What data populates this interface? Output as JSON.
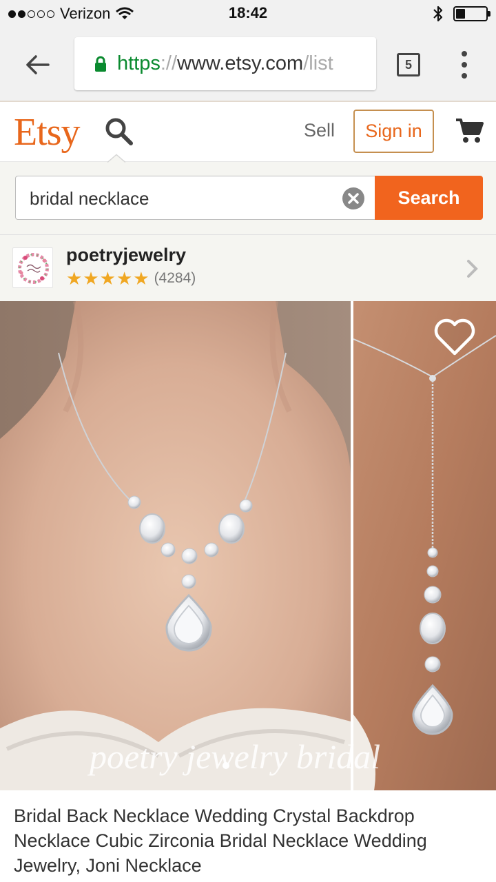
{
  "status_bar": {
    "carrier": "Verizon",
    "time": "18:42",
    "signal_bars_filled": 2,
    "signal_bars_total": 5,
    "battery_level": 0.3
  },
  "browser": {
    "url_scheme": "https",
    "url_sep": "://",
    "url_host": "www.etsy.com",
    "url_path_fade": "/list",
    "tab_count": "5"
  },
  "header": {
    "logo": "Etsy",
    "sell_label": "Sell",
    "signin_label": "Sign in"
  },
  "search": {
    "value": "bridal necklace",
    "button_label": "Search"
  },
  "shop": {
    "name": "poetryjewelry",
    "rating_stars": 5,
    "review_count": "(4284)"
  },
  "listing": {
    "watermark": "poetry jewelry bridal",
    "title": "Bridal Back Necklace Wedding Crystal Backdrop Necklace Cubic Zirconia Bridal Necklace Wedding Jewelry, Joni Necklace"
  },
  "colors": {
    "etsy_orange": "#f1641e",
    "secure_green": "#0a8a2f",
    "star_color": "#f0a722"
  },
  "icons": [
    "back-arrow-icon",
    "lock-icon",
    "search-icon",
    "cart-icon",
    "clear-icon",
    "chevron-right-icon",
    "heart-icon",
    "wifi-icon",
    "bluetooth-icon"
  ]
}
